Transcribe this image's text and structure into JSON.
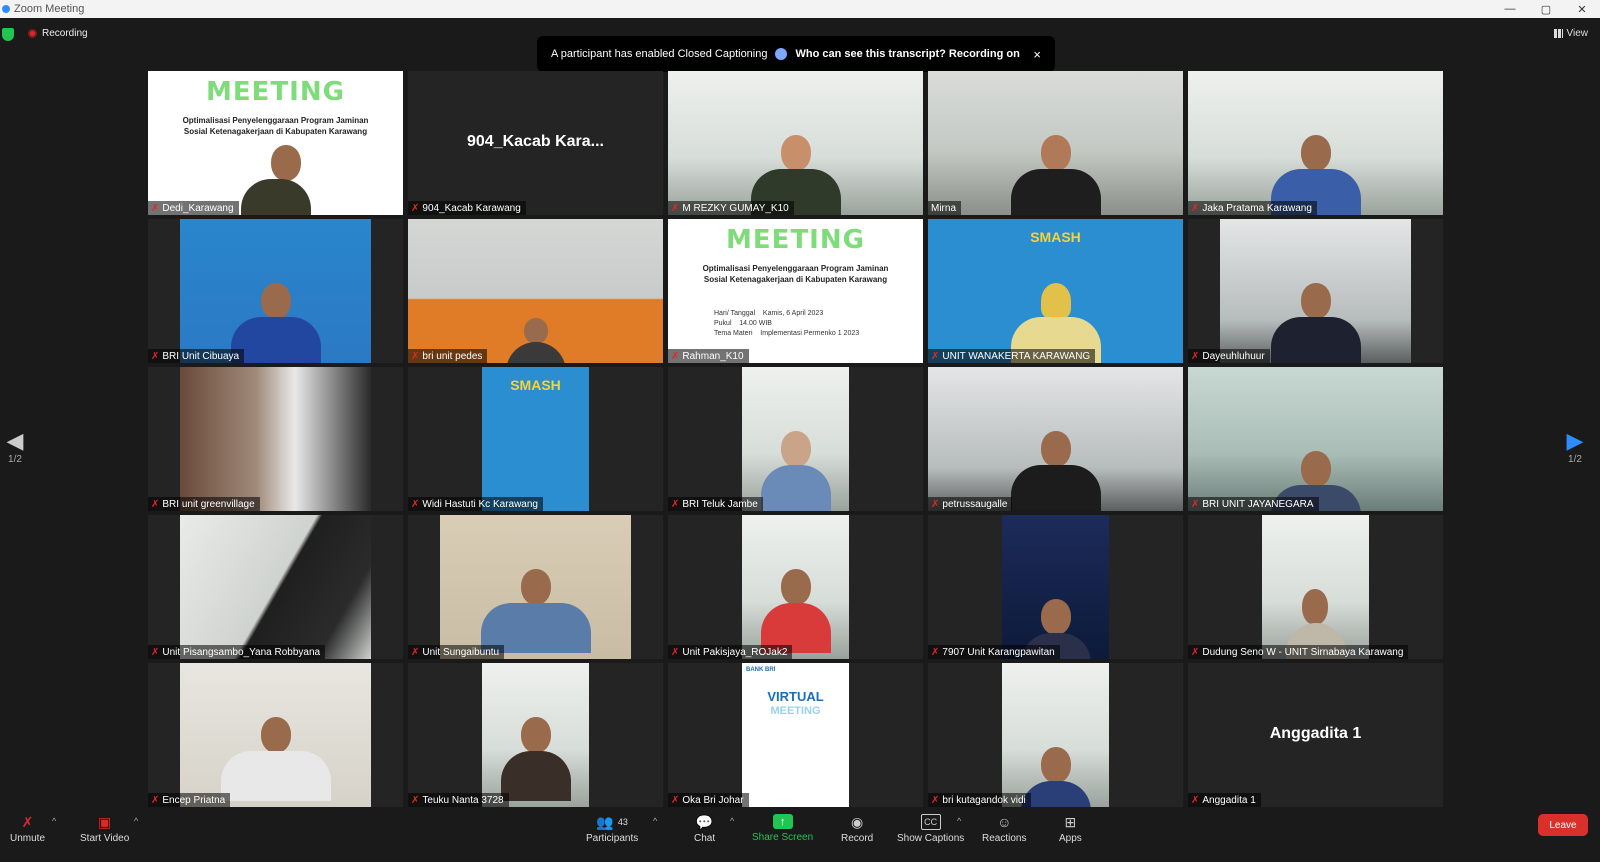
{
  "window": {
    "title": "Zoom Meeting",
    "minimize": "—",
    "maximize": "▢",
    "close": "✕"
  },
  "status": {
    "recording_label": "Recording"
  },
  "banner": {
    "text": "A participant has enabled Closed Captioning",
    "link": "Who can see this transcript? Recording on",
    "close": "×"
  },
  "view": {
    "label": "View"
  },
  "pager": {
    "left": "1/2",
    "right": "1/2",
    "left_arrow": "◀",
    "right_arrow": "▶"
  },
  "tiles": [
    {
      "name": "Dedi_Karawang"
    },
    {
      "name": "904_Kacab Karawang",
      "display_name": "904_Kacab Kara..."
    },
    {
      "name": "M REZKY GUMAY_K10"
    },
    {
      "name": "Mirna"
    },
    {
      "name": "Jaka Pratama Karawang"
    },
    {
      "name": "BRI Unit Cibuaya"
    },
    {
      "name": "bri unit pedes"
    },
    {
      "name": "Rahman_K10"
    },
    {
      "name": "UNIT WANAKERTA KARAWANG"
    },
    {
      "name": "Dayeuhluhuur"
    },
    {
      "name": "BRI unit greenvillage"
    },
    {
      "name": "Widi Hastuti Kc Karawang"
    },
    {
      "name": "BRI Teluk Jambe"
    },
    {
      "name": "petrussaugalle"
    },
    {
      "name": "BRI UNIT JAYANEGARA"
    },
    {
      "name": "Unit Pisangsambo_Yana Robbyana"
    },
    {
      "name": "Unit Sungaibuntu"
    },
    {
      "name": "Unit Pakisjaya_ROJak2"
    },
    {
      "name": "7907 Unit Karangpawitan"
    },
    {
      "name": "Dudung Seno W - UNIT Sirnabaya Karawang"
    },
    {
      "name": "Encep Priatna"
    },
    {
      "name": "Teuku Nanta 3728"
    },
    {
      "name": "Oka Bri Johar"
    },
    {
      "name": "bri kutagandok vidi"
    },
    {
      "name": "Anggadita 1",
      "display_name": "Anggadita 1"
    }
  ],
  "slide": {
    "title": "MEETING",
    "subtitle": "Optimalisasi Penyelenggaraan Program Jaminan Sosial Ketenagakerjaan di Kabupaten Karawang",
    "info": "Hari/ Tanggal    Kamis, 6 April 2023\nPukul    14.00 WIB\nTema Materi    Implementasi Permenko 1 2023"
  },
  "smash": {
    "title": "SMASH"
  },
  "vm": {
    "logo": "BANK BRI",
    "title": "VIRTUAL",
    "title2": "MEETING"
  },
  "toolbar": {
    "unmute": "Unmute",
    "start_video": "Start Video",
    "participants": "Participants",
    "participant_count": "43",
    "chat": "Chat",
    "share_screen": "Share Screen",
    "record": "Record",
    "show_captions": "Show Captions",
    "reactions": "Reactions",
    "apps": "Apps",
    "leave": "Leave"
  }
}
